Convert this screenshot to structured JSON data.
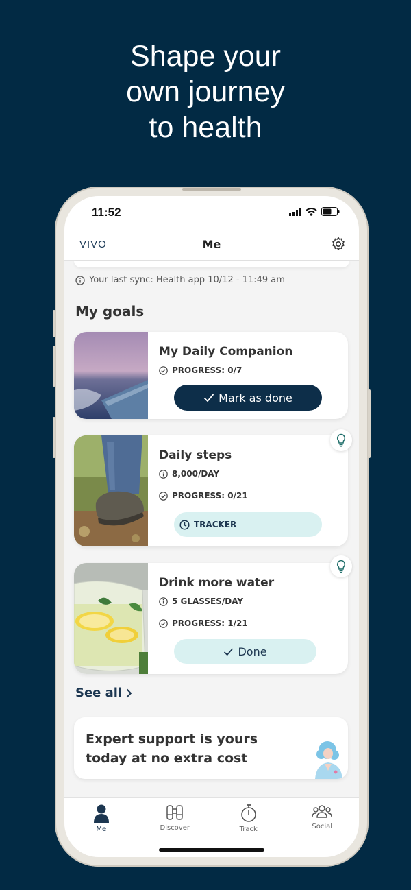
{
  "headline": [
    "Shape your",
    "own journey",
    "to health"
  ],
  "status": {
    "time": "11:52"
  },
  "appbar": {
    "logo": "VIVO",
    "title": "Me"
  },
  "sync_text": "Your last sync: Health app 10/12 - 11:49 am",
  "section_title": "My goals",
  "goals": [
    {
      "title": "My Daily Companion",
      "progress": "PROGRESS: 0/7",
      "action": "Mark as done"
    },
    {
      "title": "Daily steps",
      "target": "8,000/DAY",
      "progress": "PROGRESS: 0/21",
      "action": "TRACKER"
    },
    {
      "title": "Drink more water",
      "target": "5 GLASSES/DAY",
      "progress": "PROGRESS: 1/21",
      "action": "Done"
    }
  ],
  "see_all": "See all",
  "expert_banner": "Expert support is yours today at no extra cost",
  "tabs": [
    {
      "label": "Me",
      "icon": "person-icon",
      "active": true
    },
    {
      "label": "Discover",
      "icon": "binoculars-icon",
      "active": false
    },
    {
      "label": "Track",
      "icon": "stopwatch-icon",
      "active": false
    },
    {
      "label": "Social",
      "icon": "group-icon",
      "active": false
    }
  ],
  "colors": {
    "background": "#022a44",
    "primary_button": "#0d2e49",
    "light_button": "#d9f1f1"
  }
}
